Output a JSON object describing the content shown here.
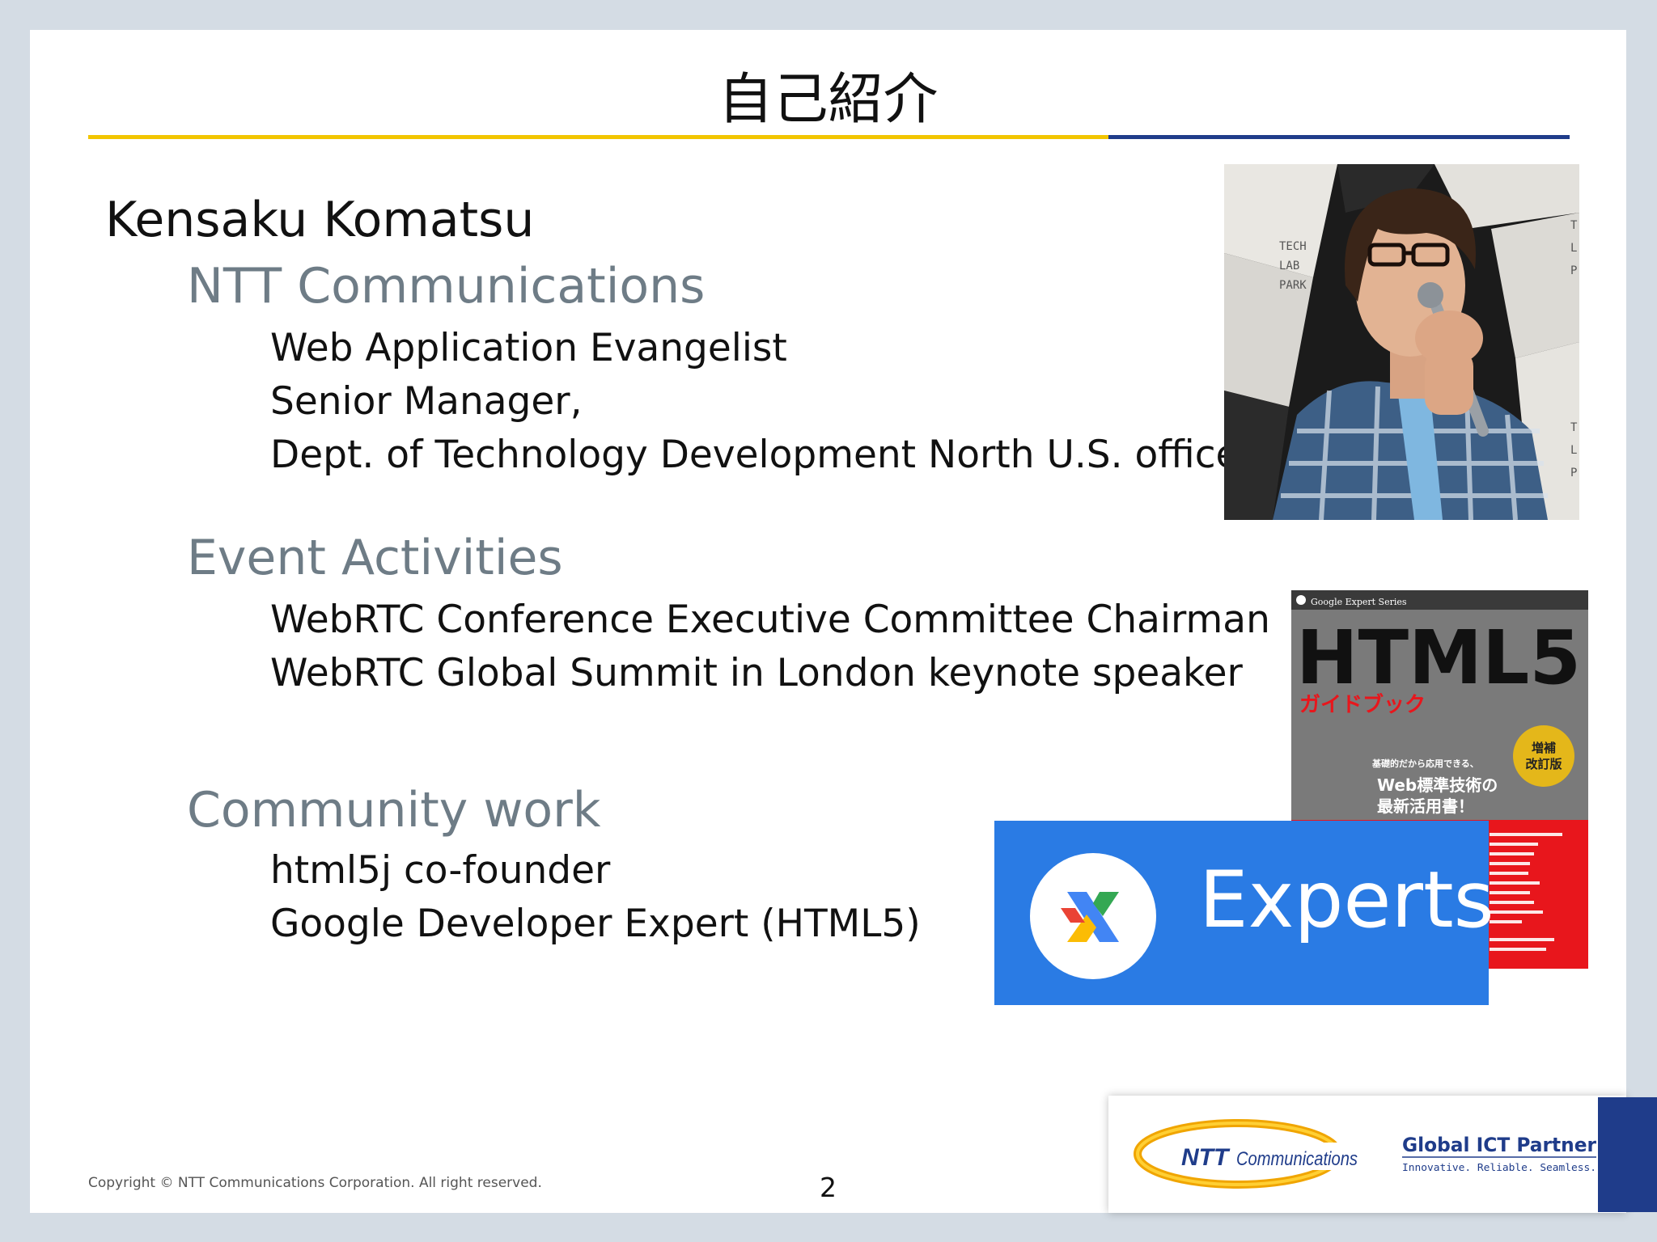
{
  "slide": {
    "title": "自己紹介",
    "name": "Kensaku Komatsu",
    "sections": [
      {
        "heading": "NTT Communications",
        "lines": [
          "Web Application Evangelist",
          "Senior Manager,",
          "Dept. of Technology Development North U.S. office"
        ]
      },
      {
        "heading": "Event Activities",
        "lines": [
          "WebRTC Conference Executive Committee Chairman",
          "WebRTC Global Summit in London keynote speaker"
        ]
      },
      {
        "heading": "Community work",
        "lines": [
          "html5j co-founder",
          "Google Developer Expert (HTML5)"
        ]
      }
    ],
    "copyright": "Copyright © NTT Communications Corporation. All right reserved.",
    "page_number": "2"
  },
  "photo": {
    "backdrop_text": [
      "TECH",
      "LAB",
      "PARK"
    ],
    "backdrop_text_right": [
      "T",
      "L",
      "P"
    ]
  },
  "book": {
    "series": "Google Expert Series",
    "title": "HTML5",
    "subtitle": "ガイドブック",
    "badge_line1": "増補",
    "badge_line2": "改訂版",
    "tagline1": "基礎的だから応用できる、",
    "tagline2": "Web標準技術の",
    "tagline3": "最新活用書！"
  },
  "experts_badge": {
    "label": "Experts"
  },
  "logo": {
    "ntt": "NTT",
    "communications": "Communications",
    "partner": "Global ICT Partner",
    "slogan": "Innovative. Reliable. Seamless."
  },
  "colors": {
    "accent_yellow": "#f2c500",
    "accent_blue": "#1f3c8a",
    "heading_gray": "#6e7c86",
    "experts_blue": "#2a7be4",
    "book_red": "#e8161c"
  }
}
